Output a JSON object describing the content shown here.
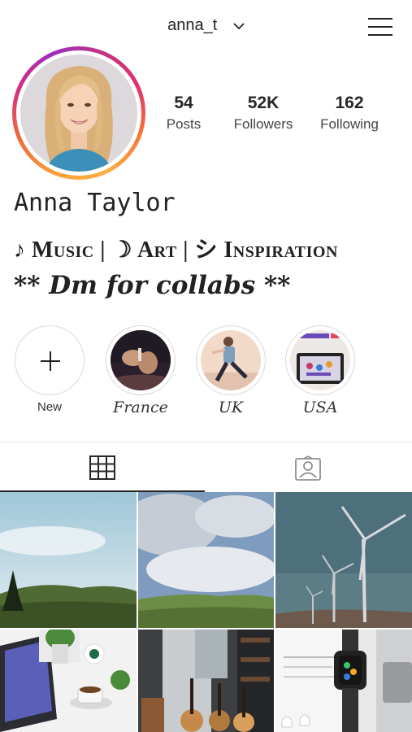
{
  "header": {
    "username": "anna_t",
    "icons": {
      "dropdown": "chevron-down-icon",
      "menu": "hamburger-menu-icon"
    }
  },
  "profile": {
    "stats": [
      {
        "value": "54",
        "label": "Posts"
      },
      {
        "value": "52K",
        "label": "Followers"
      },
      {
        "value": "162",
        "label": "Following"
      }
    ],
    "name": "Anna Taylor",
    "tagline": "♪ Music | ☽ Art | シ Inspiration",
    "bio_line": "** Dm for collabs **"
  },
  "highlights": [
    {
      "label": "New",
      "icon": "plus-icon"
    },
    {
      "label": "France"
    },
    {
      "label": "UK"
    },
    {
      "label": "USA"
    }
  ],
  "tabs": {
    "grid": {
      "icon": "grid-icon",
      "active": true
    },
    "tagged": {
      "icon": "tagged-person-icon",
      "active": false
    }
  },
  "colors": {
    "text": "#262626",
    "divider": "#e6e6e6",
    "story_ring": [
      "#fcaf45",
      "#f77737",
      "#e1306c",
      "#c13584",
      "#833ab4"
    ]
  }
}
